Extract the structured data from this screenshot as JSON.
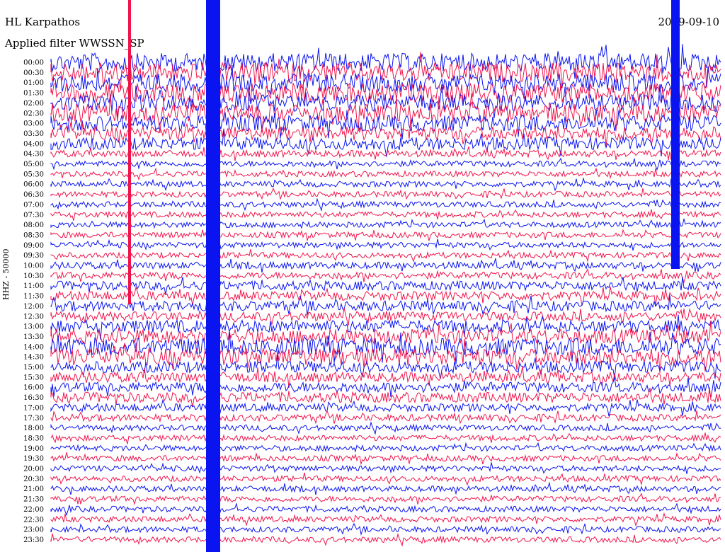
{
  "header": {
    "station": "HL Karpathos",
    "date": "2019-09-10",
    "filter": "Applied filter WWSSN_SP"
  },
  "chart_data": {
    "type": "seismogram",
    "ylabel": "HHZ - 50000",
    "colors": {
      "a": "#0a14f0",
      "b": "#f0144b"
    },
    "rows": [
      {
        "label": "00:00",
        "color": "a",
        "amp": 1.6
      },
      {
        "label": "00:30",
        "color": "b",
        "amp": 1.7
      },
      {
        "label": "01:00",
        "color": "a",
        "amp": 1.6
      },
      {
        "label": "01:30",
        "color": "b",
        "amp": 1.7
      },
      {
        "label": "02:00",
        "color": "a",
        "amp": 1.5
      },
      {
        "label": "02:30",
        "color": "b",
        "amp": 1.6
      },
      {
        "label": "03:00",
        "color": "a",
        "amp": 1.4
      },
      {
        "label": "03:30",
        "color": "b",
        "amp": 1.2
      },
      {
        "label": "04:00",
        "color": "a",
        "amp": 1.1
      },
      {
        "label": "04:30",
        "color": "b",
        "amp": 0.6
      },
      {
        "label": "05:00",
        "color": "a",
        "amp": 0.5
      },
      {
        "label": "05:30",
        "color": "b",
        "amp": 0.5
      },
      {
        "label": "06:00",
        "color": "a",
        "amp": 0.5
      },
      {
        "label": "06:30",
        "color": "b",
        "amp": 0.5
      },
      {
        "label": "07:00",
        "color": "a",
        "amp": 0.5
      },
      {
        "label": "07:30",
        "color": "b",
        "amp": 0.5
      },
      {
        "label": "08:00",
        "color": "a",
        "amp": 0.5
      },
      {
        "label": "08:30",
        "color": "b",
        "amp": 0.5
      },
      {
        "label": "09:00",
        "color": "a",
        "amp": 0.5
      },
      {
        "label": "09:30",
        "color": "b",
        "amp": 0.5
      },
      {
        "label": "10:00",
        "color": "a",
        "amp": 0.6
      },
      {
        "label": "10:30",
        "color": "b",
        "amp": 0.6
      },
      {
        "label": "11:00",
        "color": "a",
        "amp": 0.8
      },
      {
        "label": "11:30",
        "color": "b",
        "amp": 0.8
      },
      {
        "label": "12:00",
        "color": "a",
        "amp": 0.9
      },
      {
        "label": "12:30",
        "color": "b",
        "amp": 0.8
      },
      {
        "label": "13:00",
        "color": "a",
        "amp": 1.1
      },
      {
        "label": "13:30",
        "color": "b",
        "amp": 1.3
      },
      {
        "label": "14:00",
        "color": "a",
        "amp": 1.5
      },
      {
        "label": "14:30",
        "color": "b",
        "amp": 1.5
      },
      {
        "label": "15:00",
        "color": "a",
        "amp": 1.0
      },
      {
        "label": "15:30",
        "color": "b",
        "amp": 0.9
      },
      {
        "label": "16:00",
        "color": "a",
        "amp": 0.9
      },
      {
        "label": "16:30",
        "color": "b",
        "amp": 0.9
      },
      {
        "label": "17:00",
        "color": "a",
        "amp": 0.7
      },
      {
        "label": "17:30",
        "color": "b",
        "amp": 0.6
      },
      {
        "label": "18:00",
        "color": "a",
        "amp": 0.5
      },
      {
        "label": "18:30",
        "color": "b",
        "amp": 0.5
      },
      {
        "label": "19:00",
        "color": "a",
        "amp": 0.5
      },
      {
        "label": "19:30",
        "color": "b",
        "amp": 0.5
      },
      {
        "label": "20:00",
        "color": "a",
        "amp": 0.5
      },
      {
        "label": "20:30",
        "color": "b",
        "amp": 0.5
      },
      {
        "label": "21:00",
        "color": "a",
        "amp": 0.5
      },
      {
        "label": "21:30",
        "color": "b",
        "amp": 0.5
      },
      {
        "label": "22:00",
        "color": "a",
        "amp": 0.5
      },
      {
        "label": "22:30",
        "color": "b",
        "amp": 0.5
      },
      {
        "label": "23:00",
        "color": "a",
        "amp": 0.5
      },
      {
        "label": "23:30",
        "color": "b",
        "amp": 0.5
      }
    ]
  }
}
